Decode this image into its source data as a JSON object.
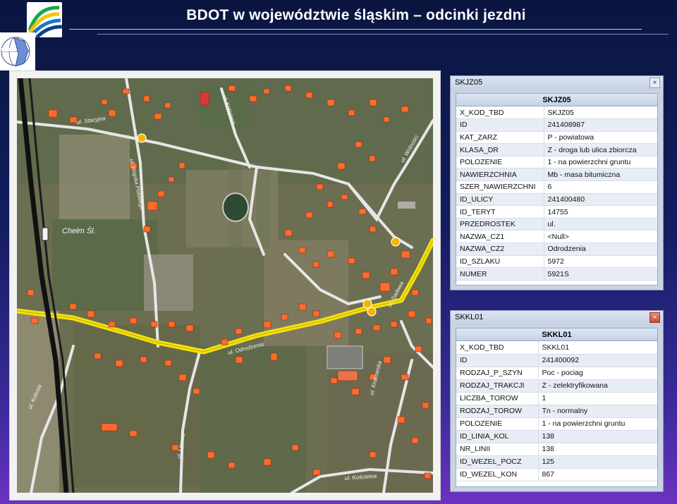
{
  "header": {
    "title": "BDOT w województwie śląskim – odcinki  jezdni"
  },
  "colors": {
    "background_top": "#0a1640",
    "background_bottom": "#6b32c0",
    "road_highlight": "#f5e20a",
    "building": "#ff6b2d"
  },
  "map": {
    "street_labels": [
      "ul. Stacyjna",
      "ul. Wojska Polskiego",
      "ul. Kolejowa",
      "ul. Wolności",
      "ul. Sadowa",
      "ul. Odrodzenia",
      "ul. Kolonia",
      "ul. Lipowa",
      "ul. Krakowska",
      "ul. Kościelna"
    ],
    "place_label": "Chełm Śl."
  },
  "window_skjz": {
    "title": "SKJZ05",
    "header": "SKJZ05",
    "close": "×",
    "rows": [
      {
        "key": "X_KOD_TBD",
        "value": "SKJZ05"
      },
      {
        "key": "ID",
        "value": "241408987"
      },
      {
        "key": "KAT_ZARZ",
        "value": "P - powiatowa"
      },
      {
        "key": "KLASA_DR",
        "value": "Z - droga lub ulica zbiorcza"
      },
      {
        "key": "POLOZENIE",
        "value": "1 - na powierzchni gruntu"
      },
      {
        "key": "NAWIERZCHNIA",
        "value": "Mb - masa bitumiczna"
      },
      {
        "key": "SZER_NAWIERZCHNI",
        "value": "6"
      },
      {
        "key": "ID_ULICY",
        "value": "241400480"
      },
      {
        "key": "ID_TERYT",
        "value": "14755"
      },
      {
        "key": "PRZEDROSTEK",
        "value": "ul."
      },
      {
        "key": "NAZWA_CZ1",
        "value": "<Null>"
      },
      {
        "key": "NAZWA_CZ2",
        "value": "Odrodzenia"
      },
      {
        "key": "ID_SZLAKU",
        "value": "5972"
      },
      {
        "key": "NUMER",
        "value": "5921S"
      }
    ]
  },
  "window_skkl": {
    "title": "SKKL01",
    "header": "SKKL01",
    "close": "×",
    "rows": [
      {
        "key": "X_KOD_TBD",
        "value": "SKKL01"
      },
      {
        "key": "ID",
        "value": "241400092"
      },
      {
        "key": "RODZAJ_P_SZYN",
        "value": "Poc - pociag"
      },
      {
        "key": "RODZAJ_TRAKCJI",
        "value": "Z - zelektryfikowana"
      },
      {
        "key": "LICZBA_TOROW",
        "value": "1"
      },
      {
        "key": "RODZAJ_TOROW",
        "value": "Tn - normalny"
      },
      {
        "key": "POLOZENIE",
        "value": "1 - na powierzchni gruntu"
      },
      {
        "key": "ID_LINIA_KOL",
        "value": "138"
      },
      {
        "key": "NR_LINII",
        "value": "138"
      },
      {
        "key": "ID_WEZEL_POCZ",
        "value": "125"
      },
      {
        "key": "ID_WEZEL_KON",
        "value": "867"
      }
    ]
  }
}
